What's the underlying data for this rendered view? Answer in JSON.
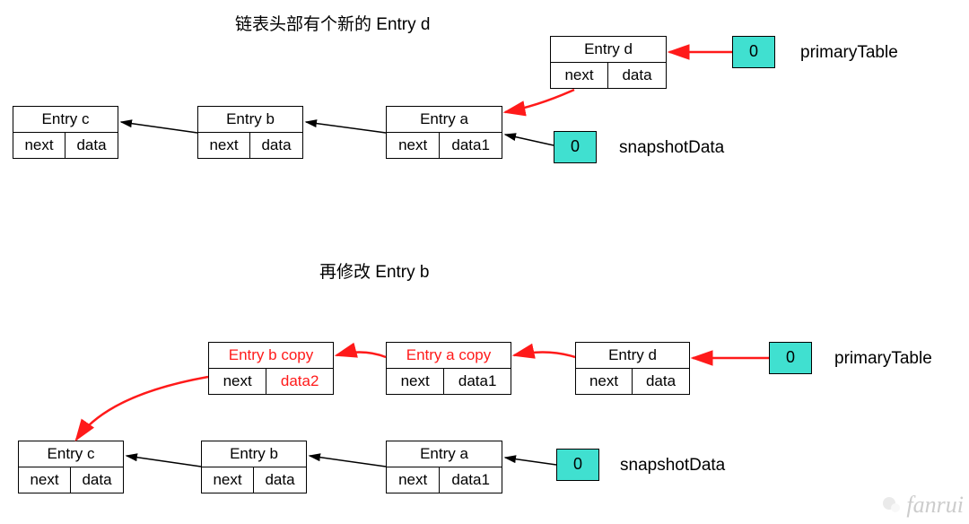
{
  "top": {
    "caption": "链表头部有个新的 Entry d",
    "primaryLabel": "primaryTable",
    "snapshotLabel": "snapshotData",
    "bucketPrimary": "0",
    "bucketSnapshot": "0",
    "entries": {
      "d": {
        "title": "Entry d",
        "next": "next",
        "data": "data"
      },
      "a": {
        "title": "Entry a",
        "next": "next",
        "data": "data1"
      },
      "b": {
        "title": "Entry b",
        "next": "next",
        "data": "data"
      },
      "c": {
        "title": "Entry c",
        "next": "next",
        "data": "data"
      }
    }
  },
  "bottom": {
    "caption": "再修改 Entry b",
    "primaryLabel": "primaryTable",
    "snapshotLabel": "snapshotData",
    "bucketPrimary": "0",
    "bucketSnapshot": "0",
    "entries": {
      "d": {
        "title": "Entry d",
        "next": "next",
        "data": "data"
      },
      "acopy": {
        "title": "Entry a copy",
        "next": "next",
        "data": "data1"
      },
      "bcopy": {
        "title": "Entry b copy",
        "next": "next",
        "data": "data2"
      },
      "a": {
        "title": "Entry a",
        "next": "next",
        "data": "data1"
      },
      "b": {
        "title": "Entry b",
        "next": "next",
        "data": "data"
      },
      "c": {
        "title": "Entry c",
        "next": "next",
        "data": "data"
      }
    }
  },
  "watermark": "fanrui"
}
